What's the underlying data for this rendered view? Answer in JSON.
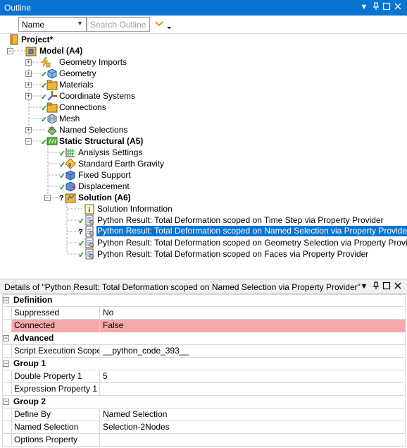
{
  "outline": {
    "title": "Outline",
    "toolbar": {
      "name_select": "Name",
      "search_placeholder": "Search Outline"
    },
    "tree": [
      {
        "label": "Project*",
        "bold": true
      },
      {
        "label": "Model (A4)",
        "bold": true
      },
      {
        "label": "Geometry Imports"
      },
      {
        "label": "Geometry"
      },
      {
        "label": "Materials"
      },
      {
        "label": "Coordinate Systems"
      },
      {
        "label": "Connections"
      },
      {
        "label": "Mesh"
      },
      {
        "label": "Named Selections"
      },
      {
        "label": "Static Structural (A5)",
        "bold": true
      },
      {
        "label": "Analysis Settings"
      },
      {
        "label": "Standard Earth Gravity"
      },
      {
        "label": "Fixed Support"
      },
      {
        "label": "Displacement"
      },
      {
        "label": "Solution (A6)",
        "bold": true
      },
      {
        "label": "Solution Information"
      },
      {
        "label": "Python Result: Total Deformation scoped on Time Step via Property Provider"
      },
      {
        "label": "Python Result: Total Deformation scoped on Named Selection via Property Provider",
        "selected": true
      },
      {
        "label": "Python Result: Total Deformation scoped on Geometry Selection via Property Provider"
      },
      {
        "label": "Python Result: Total Deformation scoped on Faces via Property Provider"
      }
    ]
  },
  "details": {
    "title": "Details of \"Python Result: Total Deformation scoped on Named Selection via Property Provider\"",
    "sections": [
      {
        "name": "Definition",
        "rows": [
          {
            "key": "Suppressed",
            "value": "No"
          },
          {
            "key": "Connected",
            "value": "False",
            "highlight": true
          }
        ]
      },
      {
        "name": "Advanced",
        "rows": [
          {
            "key": "Script Execution Scope",
            "value": "__python_code_393__"
          }
        ]
      },
      {
        "name": "Group 1",
        "rows": [
          {
            "key": "Double Property 1",
            "value": "5"
          },
          {
            "key": "Expression Property 1",
            "value": ""
          }
        ]
      },
      {
        "name": "Group 2",
        "rows": [
          {
            "key": "Define By",
            "value": "Named Selection"
          },
          {
            "key": "Named Selection",
            "value": "Selection-2Nodes"
          },
          {
            "key": "Options Property",
            "value": ""
          }
        ]
      }
    ]
  },
  "colors": {
    "titlebar": "#0a74d2",
    "selection": "#0a74d2",
    "error_row": "#f6a9ad",
    "check": "#1c8f1c"
  }
}
